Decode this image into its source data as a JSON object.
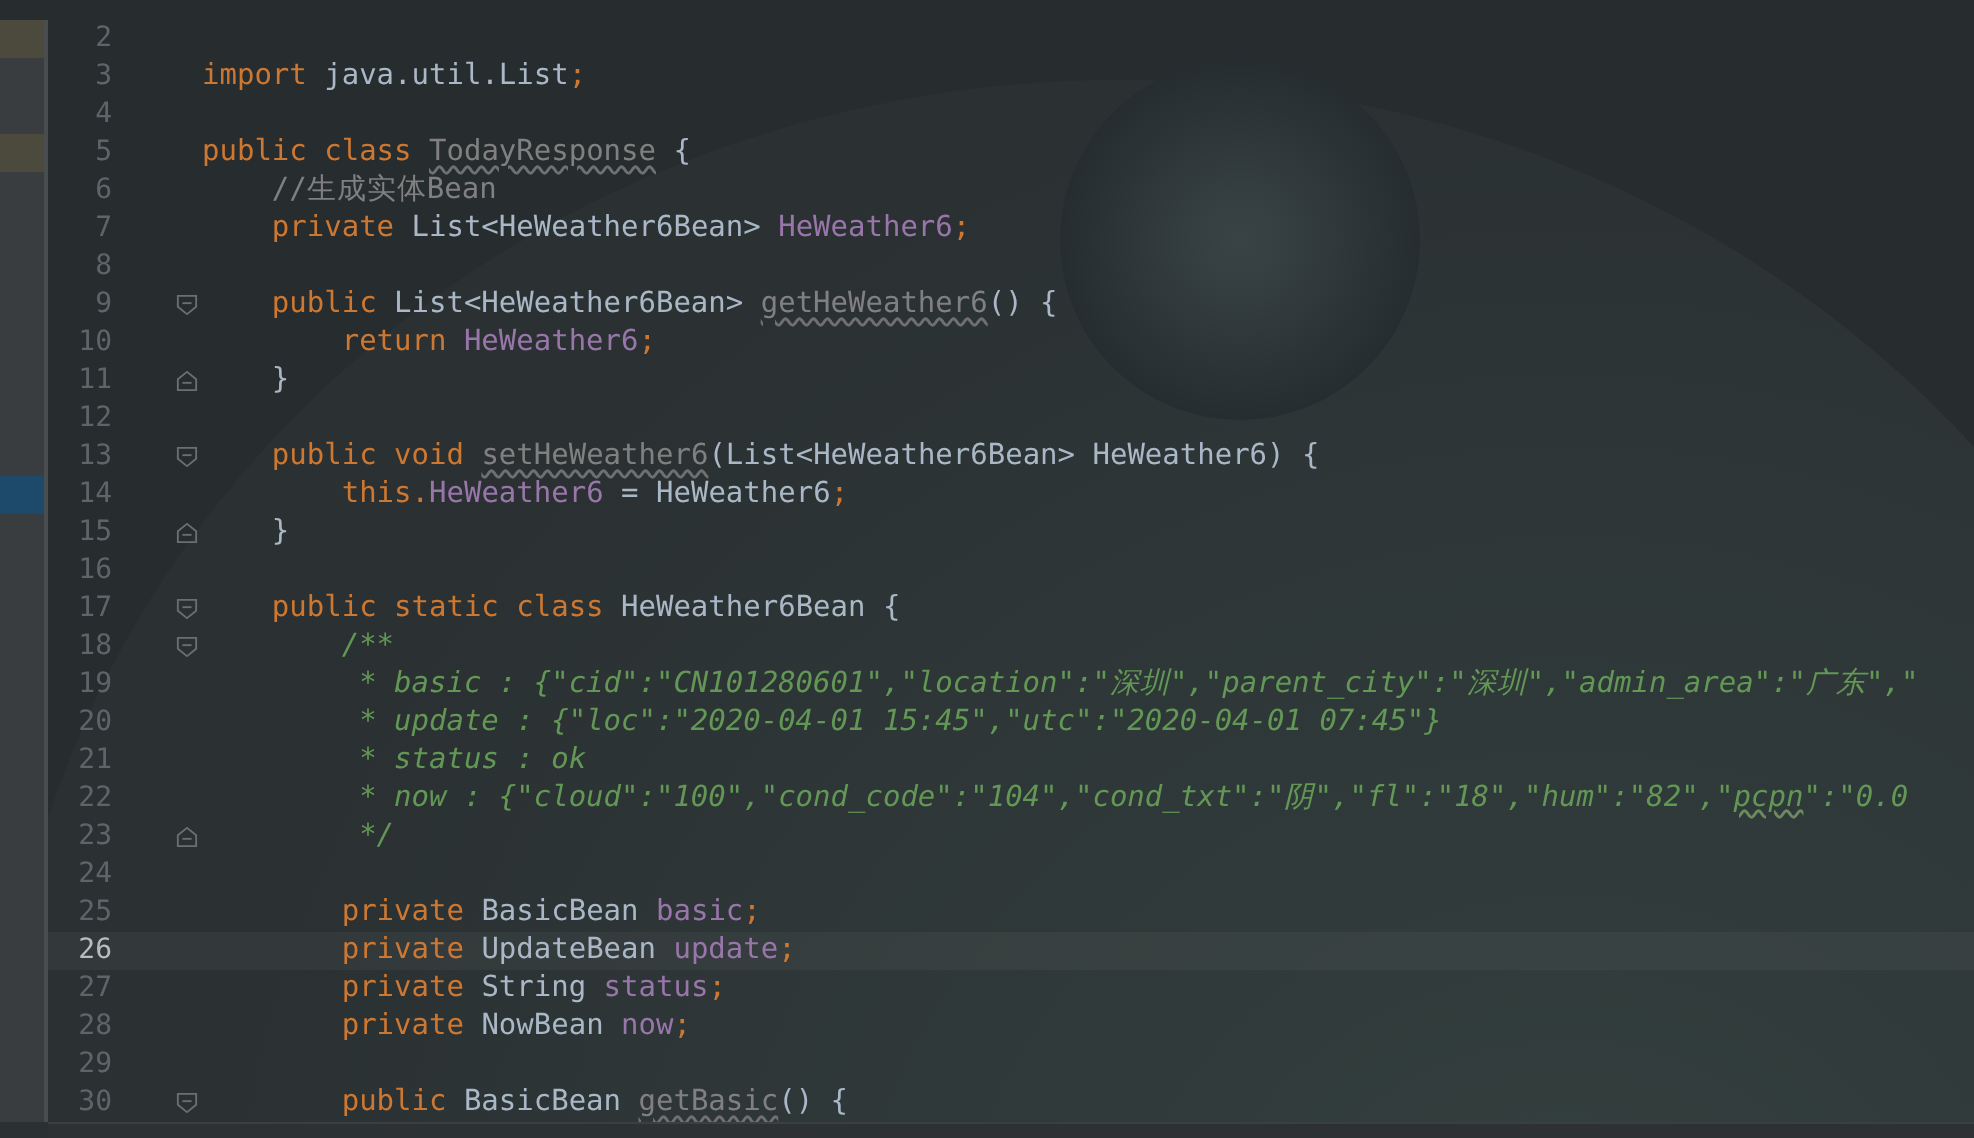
{
  "editor": {
    "lines": [
      {
        "number": "2",
        "changed": true
      },
      {
        "number": "3",
        "tokens": [
          {
            "kind": "kw",
            "text": "import "
          },
          {
            "kind": "plain",
            "text": "java.util.List"
          },
          {
            "kind": "kw",
            "text": ";"
          }
        ]
      },
      {
        "number": "4"
      },
      {
        "number": "5",
        "changed": true,
        "tokens": [
          {
            "kind": "kw",
            "text": "public class "
          },
          {
            "kind": "unused",
            "text": "TodayResponse"
          },
          {
            "kind": "plain",
            "text": " {"
          }
        ]
      },
      {
        "number": "6",
        "tokens": [
          {
            "kind": "comment",
            "text": "    //生成实体Bean"
          }
        ]
      },
      {
        "number": "7",
        "tokens": [
          {
            "kind": "kw",
            "text": "    private "
          },
          {
            "kind": "plain",
            "text": "List<HeWeather6Bean> "
          },
          {
            "kind": "field",
            "text": "HeWeather6"
          },
          {
            "kind": "kw",
            "text": ";"
          }
        ]
      },
      {
        "number": "8"
      },
      {
        "number": "9",
        "fold_start": true,
        "tokens": [
          {
            "kind": "kw",
            "text": "    public "
          },
          {
            "kind": "plain",
            "text": "List<HeWeather6Bean> "
          },
          {
            "kind": "unused",
            "text": "getHeWeather6"
          },
          {
            "kind": "plain",
            "text": "() {"
          }
        ]
      },
      {
        "number": "10",
        "tokens": [
          {
            "kind": "kw",
            "text": "        return "
          },
          {
            "kind": "field",
            "text": "HeWeather6"
          },
          {
            "kind": "kw",
            "text": ";"
          }
        ]
      },
      {
        "number": "11",
        "fold_end": true,
        "tokens": [
          {
            "kind": "plain",
            "text": "    }"
          }
        ]
      },
      {
        "number": "12"
      },
      {
        "number": "13",
        "fold_start": true,
        "tokens": [
          {
            "kind": "kw",
            "text": "    public void "
          },
          {
            "kind": "unused",
            "text": "setHeWeather6"
          },
          {
            "kind": "plain",
            "text": "(List<HeWeather6Bean> HeWeather6) {"
          }
        ]
      },
      {
        "number": "14",
        "highlighted": true,
        "tokens": [
          {
            "kind": "kw",
            "text": "        this."
          },
          {
            "kind": "field",
            "text": "HeWeather6"
          },
          {
            "kind": "plain",
            "text": " = HeWeather6"
          },
          {
            "kind": "kw",
            "text": ";"
          }
        ]
      },
      {
        "number": "15",
        "fold_end": true,
        "tokens": [
          {
            "kind": "plain",
            "text": "    }"
          }
        ]
      },
      {
        "number": "16"
      },
      {
        "number": "17",
        "fold_start": true,
        "tokens": [
          {
            "kind": "kw",
            "text": "    public static class "
          },
          {
            "kind": "plain",
            "text": "HeWeather6Bean {"
          }
        ]
      },
      {
        "number": "18",
        "fold_start": true,
        "tokens": [
          {
            "kind": "doc",
            "text": "        /**"
          }
        ]
      },
      {
        "number": "19",
        "tokens": [
          {
            "kind": "doc",
            "text": "         * basic : {\"cid\":\"CN101280601\",\"location\":\"深圳\",\"parent_city\":\"深圳\",\"admin_area\":\"广东\",\""
          }
        ]
      },
      {
        "number": "20",
        "tokens": [
          {
            "kind": "doc",
            "text": "         * update : {\"loc\":\"2020-04-01 15:45\",\"utc\":\"2020-04-01 07:45\"}"
          }
        ]
      },
      {
        "number": "21",
        "tokens": [
          {
            "kind": "doc",
            "text": "         * status : ok"
          }
        ]
      },
      {
        "number": "22",
        "tokens": [
          {
            "kind": "doc",
            "text": "         * now : {\"cloud\":\"100\",\"cond_code\":\"104\",\"cond_txt\":\"阴\",\"fl\":\"18\",\"hum\":\"82\",\""
          },
          {
            "kind": "doc-typo",
            "text": "pcpn"
          },
          {
            "kind": "doc",
            "text": "\":\"0.0"
          }
        ]
      },
      {
        "number": "23",
        "fold_end": true,
        "tokens": [
          {
            "kind": "doc",
            "text": "         */"
          }
        ]
      },
      {
        "number": "24"
      },
      {
        "number": "25",
        "tokens": [
          {
            "kind": "kw",
            "text": "        private "
          },
          {
            "kind": "plain",
            "text": "BasicBean "
          },
          {
            "kind": "field",
            "text": "basic"
          },
          {
            "kind": "kw",
            "text": ";"
          }
        ]
      },
      {
        "number": "26",
        "current": true,
        "tokens": [
          {
            "kind": "kw",
            "text": "        private "
          },
          {
            "kind": "plain",
            "text": "UpdateBean "
          },
          {
            "kind": "field",
            "text": "update"
          },
          {
            "kind": "kw",
            "text": ";"
          }
        ]
      },
      {
        "number": "27",
        "tokens": [
          {
            "kind": "kw",
            "text": "        private "
          },
          {
            "kind": "plain",
            "text": "String "
          },
          {
            "kind": "field",
            "text": "status"
          },
          {
            "kind": "kw",
            "text": ";"
          }
        ]
      },
      {
        "number": "28",
        "tokens": [
          {
            "kind": "kw",
            "text": "        private "
          },
          {
            "kind": "plain",
            "text": "NowBean "
          },
          {
            "kind": "field",
            "text": "now"
          },
          {
            "kind": "kw",
            "text": ";"
          }
        ]
      },
      {
        "number": "29"
      },
      {
        "number": "30",
        "fold_start": true,
        "tokens": [
          {
            "kind": "kw",
            "text": "        public "
          },
          {
            "kind": "plain",
            "text": "BasicBean "
          },
          {
            "kind": "unused",
            "text": "getBasic"
          },
          {
            "kind": "plain",
            "text": "() {"
          }
        ]
      }
    ]
  }
}
